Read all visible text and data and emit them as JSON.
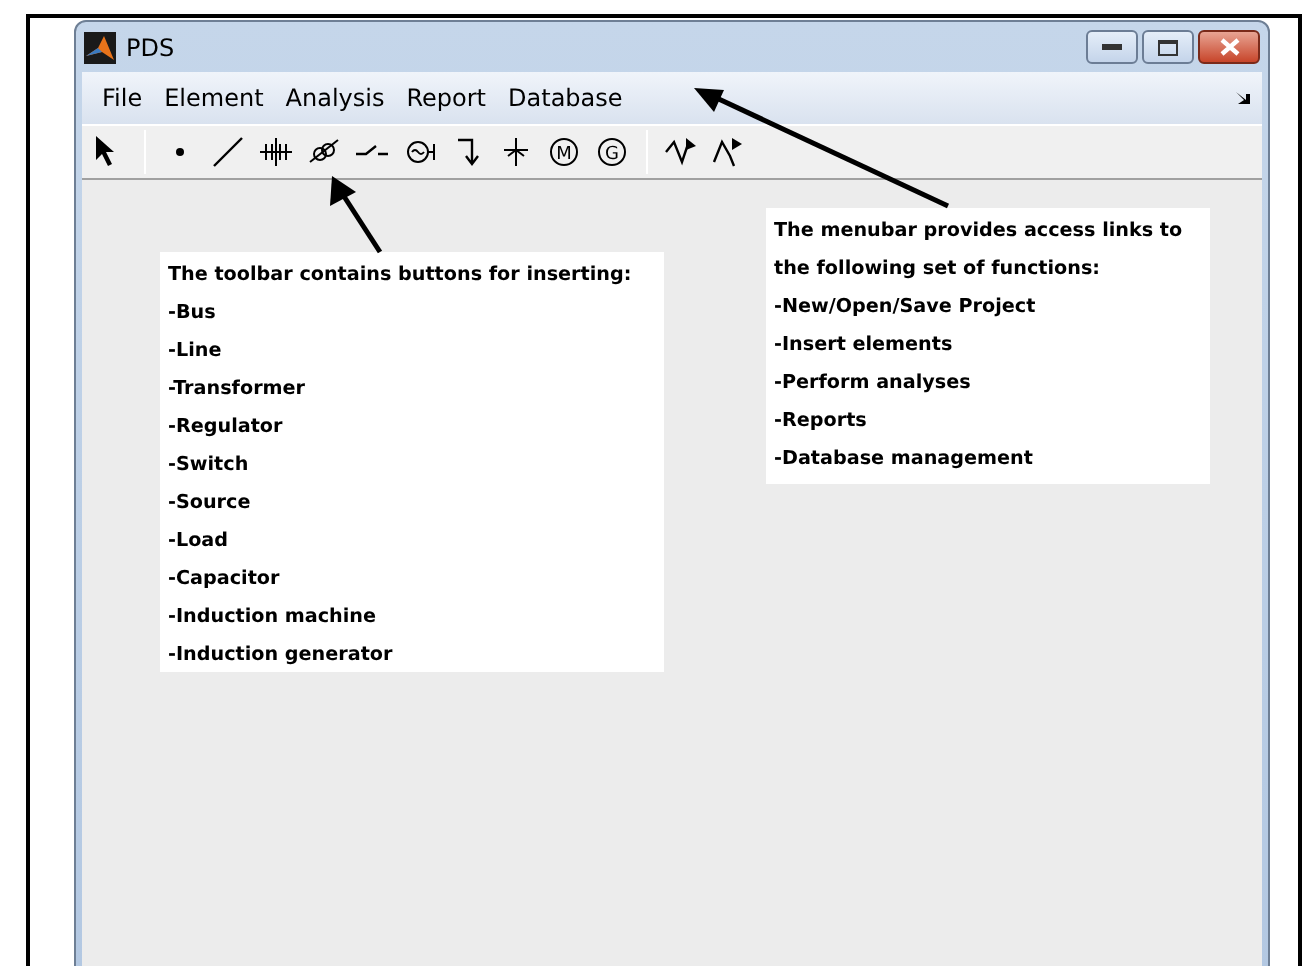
{
  "window": {
    "title": "PDS"
  },
  "menubar": {
    "items": [
      "File",
      "Element",
      "Analysis",
      "Report",
      "Database"
    ]
  },
  "toolbar": [
    {
      "kind": "pointer"
    },
    {
      "kind": "separator"
    },
    {
      "kind": "bus"
    },
    {
      "kind": "line"
    },
    {
      "kind": "transformer"
    },
    {
      "kind": "regulator"
    },
    {
      "kind": "switch"
    },
    {
      "kind": "source"
    },
    {
      "kind": "load"
    },
    {
      "kind": "capacitor"
    },
    {
      "kind": "letter",
      "letter": "M"
    },
    {
      "kind": "letter",
      "letter": "G"
    },
    {
      "kind": "separator"
    },
    {
      "kind": "wave"
    },
    {
      "kind": "wave2"
    }
  ],
  "annotations": [
    {
      "lines": [
        "The toolbar contains buttons for inserting:",
        "-Bus",
        "-Line",
        "-Transformer",
        "-Regulator",
        "-Switch",
        "-Source",
        "-Load",
        "-Capacitor",
        "-Induction machine",
        "-Induction generator"
      ]
    },
    {
      "lines": [
        "The menubar provides access links to",
        "the following set of functions:",
        "-New/Open/Save Project",
        "-Insert elements",
        "-Perform analyses",
        "-Reports",
        "-Database management"
      ]
    }
  ]
}
